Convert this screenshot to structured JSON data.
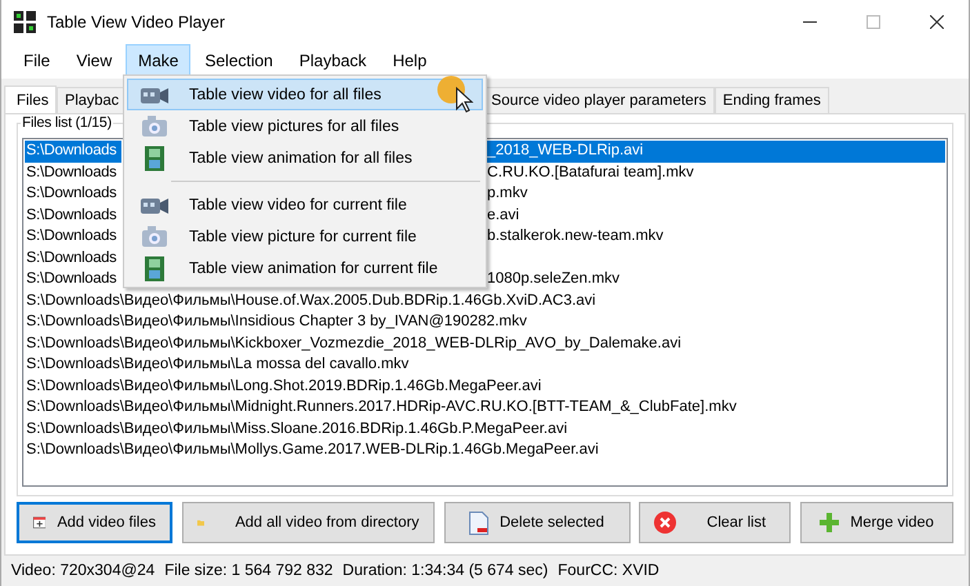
{
  "window": {
    "title": "Table View Video Player"
  },
  "menubar": [
    {
      "label": "File",
      "selected": false
    },
    {
      "label": "View",
      "selected": false
    },
    {
      "label": "Make",
      "selected": true
    },
    {
      "label": "Selection",
      "selected": false
    },
    {
      "label": "Playback",
      "selected": false
    },
    {
      "label": "Help",
      "selected": false
    }
  ],
  "tabs": [
    {
      "label": "Files",
      "selected": true
    },
    {
      "label": "Playbac",
      "selected": false
    },
    {
      "label": "Source video player parameters",
      "selected": false
    },
    {
      "label": "Ending frames",
      "selected": false
    }
  ],
  "files_list": {
    "title": "Files list (1/15)",
    "rows": [
      {
        "start": "S:\\Downloads",
        "end": "_2018_WEB-DLRip.avi",
        "selected": true
      },
      {
        "start": "S:\\Downloads",
        "end": "C.RU.KO.[Batafurai team].mkv",
        "selected": false
      },
      {
        "start": "S:\\Downloads",
        "end": "p.mkv",
        "selected": false
      },
      {
        "start": "S:\\Downloads",
        "end": "e.avi",
        "selected": false
      },
      {
        "start": "S:\\Downloads",
        "end": "b.stalkerok.new-team.mkv",
        "selected": false
      },
      {
        "start": "S:\\Downloads",
        "selected": false
      },
      {
        "start": "S:\\Downloads",
        "end": "1080p.seleZen.mkv",
        "selected": false
      },
      {
        "text": "S:\\Downloads\\Видео\\Фильмы\\House.of.Wax.2005.Dub.BDRip.1.46Gb.XviD.AC3.avi",
        "selected": false
      },
      {
        "text": "S:\\Downloads\\Видео\\Фильмы\\Insidious Chapter 3 by_IVAN@190282.mkv",
        "selected": false
      },
      {
        "text": "S:\\Downloads\\Видео\\Фильмы\\Kickboxer_Vozmezdie_2018_WEB-DLRip_AVO_by_Dalemake.avi",
        "selected": false
      },
      {
        "text": "S:\\Downloads\\Видео\\Фильмы\\La mossa del cavallo.mkv",
        "selected": false
      },
      {
        "text": "S:\\Downloads\\Видео\\Фильмы\\Long.Shot.2019.BDRip.1.46Gb.MegaPeer.avi",
        "selected": false
      },
      {
        "text": "S:\\Downloads\\Видео\\Фильмы\\Midnight.Runners.2017.HDRip-AVC.RU.KO.[BTT-TEAM_&_ClubFate].mkv",
        "selected": false
      },
      {
        "text": "S:\\Downloads\\Видео\\Фильмы\\Miss.Sloane.2016.BDRip.1.46Gb.P.MegaPeer.avi",
        "selected": false
      },
      {
        "text": "S:\\Downloads\\Видео\\Фильмы\\Mollys.Game.2017.WEB-DLRip.1.46Gb.MegaPeer.avi",
        "selected": false
      }
    ]
  },
  "buttons": [
    {
      "label": "Add video files",
      "kind": "add",
      "focused": true
    },
    {
      "label": "Add all video from directory",
      "kind": "folder",
      "focused": false
    },
    {
      "label": "Delete selected",
      "kind": "delete",
      "focused": false
    },
    {
      "label": "Clear list",
      "kind": "clear",
      "focused": false
    },
    {
      "label": "Merge video",
      "kind": "merge",
      "focused": false
    }
  ],
  "status_bar": [
    "Video: 720x304@24",
    "File size: 1 564 792 832",
    "Duration: 1:34:34 (5 674 sec)",
    "FourCC: XVID"
  ],
  "make_menu": [
    {
      "label": "Table view video for all files",
      "kind": "video",
      "selected": true
    },
    {
      "label": "Table view pictures for all files",
      "kind": "picture",
      "selected": false
    },
    {
      "label": "Table view animation for all files",
      "kind": "animation",
      "selected": false
    },
    {
      "kind": "separator"
    },
    {
      "label": "Table view video for current file",
      "kind": "video",
      "selected": false
    },
    {
      "label": "Table view picture for current file",
      "kind": "picture",
      "selected": false
    },
    {
      "label": "Table view animation for current file",
      "kind": "animation",
      "selected": false
    }
  ]
}
